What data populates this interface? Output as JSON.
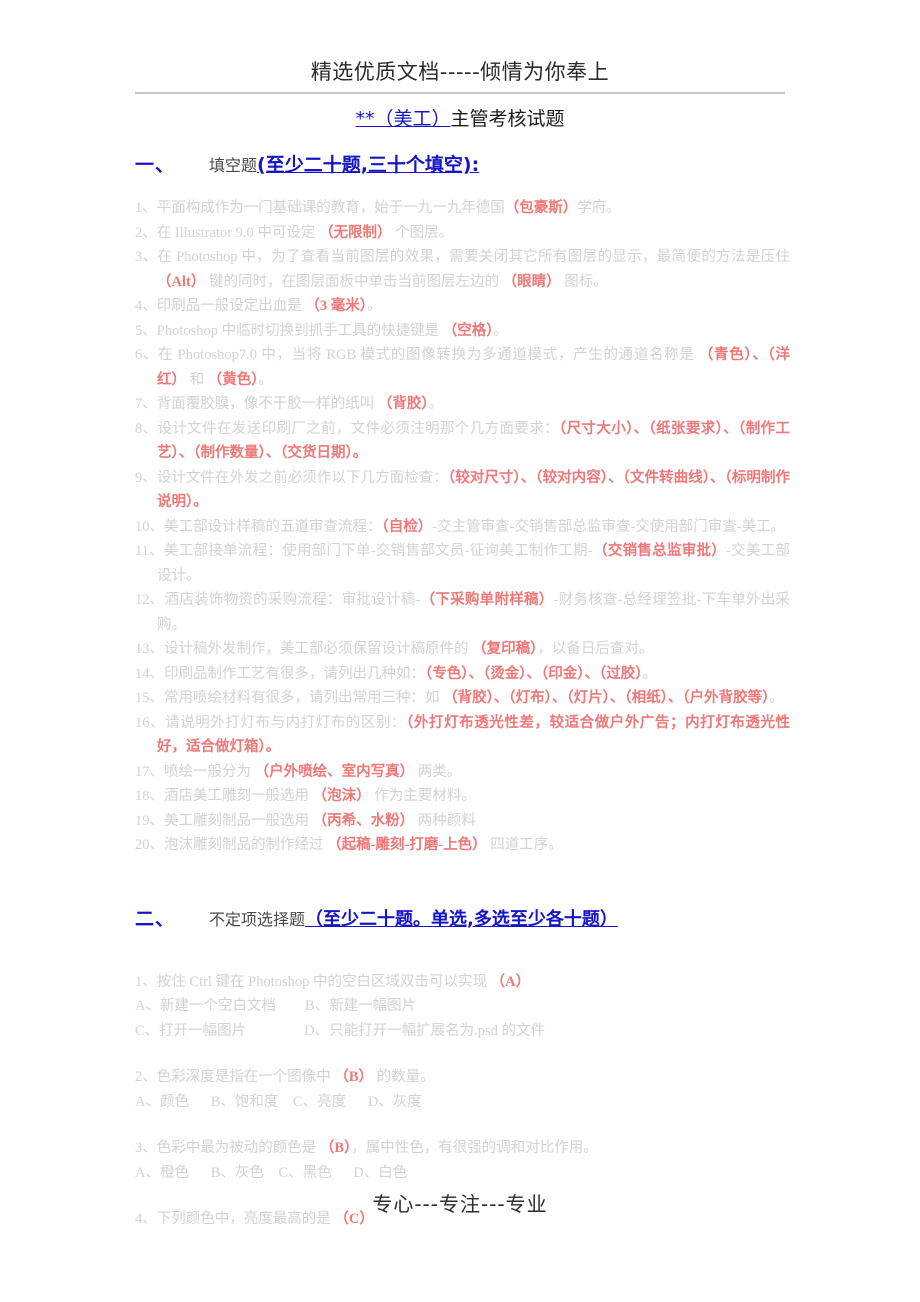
{
  "header": {
    "banner": "精选优质文档-----倾情为你奉上"
  },
  "title": {
    "prefix": "**（美工）",
    "suffix": "主管考核试题"
  },
  "sections": [
    {
      "number": "一、",
      "name": "填空题",
      "note": "(至少二十题,三十个填空):"
    },
    {
      "number": "二、",
      "name": "不定项选择题",
      "note": "（至少二十题。单选,多选至少各十题）"
    }
  ],
  "fill_in_questions": [
    {
      "id": "q1",
      "parts": [
        {
          "t": "1、平面构成作为一门基础课的教育，始于一九一九年德国",
          "a": false
        },
        {
          "t": "（包豪斯）",
          "a": true
        },
        {
          "t": "学府。",
          "a": false
        }
      ]
    },
    {
      "id": "q2",
      "parts": [
        {
          "t": "2、在 Illustrator 9.0 中可设定 ",
          "a": false
        },
        {
          "t": "（无限制）",
          "a": true
        },
        {
          "t": " 个图层。",
          "a": false
        }
      ]
    },
    {
      "id": "q3",
      "parts": [
        {
          "t": "3、在 Photoshop 中，为了查看当前图层的效果，需要关闭其它所有图层的显示，最简便的方法是压住 ",
          "a": false
        },
        {
          "t": "（Alt）",
          "a": true
        },
        {
          "t": " 键的同时，在图层面板中单击当前图层左边的 ",
          "a": false
        },
        {
          "t": "（眼睛）",
          "a": true
        },
        {
          "t": " 图标。",
          "a": false
        }
      ]
    },
    {
      "id": "q4",
      "parts": [
        {
          "t": "4、印刷品一般设定出血是 ",
          "a": false
        },
        {
          "t": "（3 毫米）",
          "a": true
        },
        {
          "t": "。",
          "a": false
        }
      ]
    },
    {
      "id": "q5",
      "parts": [
        {
          "t": "5、Photoshop 中临时切换到抓手工具的快捷键是 ",
          "a": false
        },
        {
          "t": "（空格）",
          "a": true
        },
        {
          "t": "。",
          "a": false
        }
      ]
    },
    {
      "id": "q6",
      "parts": [
        {
          "t": "6、在 Photoshop7.0 中，当将 RGB 模式的图像转换为多通道模式，产生的通道名称是 ",
          "a": false
        },
        {
          "t": "（青色）、（洋红）",
          "a": true
        },
        {
          "t": " 和 ",
          "a": false
        },
        {
          "t": "（黄色）",
          "a": true
        },
        {
          "t": "。",
          "a": false
        }
      ]
    },
    {
      "id": "q7",
      "parts": [
        {
          "t": "7、背面覆胶膜，像不干胶一样的纸叫 ",
          "a": false
        },
        {
          "t": "（背胶）",
          "a": true
        },
        {
          "t": "。",
          "a": false
        }
      ]
    },
    {
      "id": "q8",
      "parts": [
        {
          "t": "8、设计文件在发送印刷厂之前，文件必须注明那个几方面要求：",
          "a": false
        },
        {
          "t": "（尺寸大小）、（纸张要求）、（制作工艺）、（制作数量）、（交货日期）。",
          "a": true
        }
      ]
    },
    {
      "id": "q9",
      "parts": [
        {
          "t": "9、设计文件在外发之前必须作以下几方面检查：",
          "a": false
        },
        {
          "t": "（较对尺寸）、（较对内容）、（文件转曲线）、（标明制作说明）。",
          "a": true
        }
      ]
    },
    {
      "id": "q10",
      "parts": [
        {
          "t": "10、美工部设计样稿的五道审查流程：",
          "a": false
        },
        {
          "t": "（自检）",
          "a": true
        },
        {
          "t": "-交主管审查-交销售部总监审查-交使用部门审查-美工。",
          "a": false
        }
      ]
    },
    {
      "id": "q11",
      "parts": [
        {
          "t": "11、美工部接单流程：使用部门下单-交销售部文员-征询美工制作工期-",
          "a": false
        },
        {
          "t": "（交销售总监审批）",
          "a": true
        },
        {
          "t": "-交美工部设计。",
          "a": false
        }
      ]
    },
    {
      "id": "q12",
      "parts": [
        {
          "t": "12、酒店装饰物资的采购流程：审批设计稿-",
          "a": false
        },
        {
          "t": "（下采购单附样稿）",
          "a": true
        },
        {
          "t": "-财务核查-总经理签批-下车单外出采购。",
          "a": false
        }
      ]
    },
    {
      "id": "q13",
      "parts": [
        {
          "t": "13、设计稿外发制作，美工部必须保留设计稿原件的 ",
          "a": false
        },
        {
          "t": "（复印稿）",
          "a": true
        },
        {
          "t": "，以备日后查对。",
          "a": false
        }
      ]
    },
    {
      "id": "q14",
      "parts": [
        {
          "t": "14、印刷品制作工艺有很多，请列出几种如：",
          "a": false
        },
        {
          "t": "（专色）、（烫金）、（印金）、（过胶）",
          "a": true
        },
        {
          "t": "。",
          "a": false
        }
      ]
    },
    {
      "id": "q15",
      "parts": [
        {
          "t": "15、常用喷绘材料有很多，请列出常用三种：如 ",
          "a": false
        },
        {
          "t": "（背胶）、（灯布）、（灯片）、（相纸）、（户外背胶等）",
          "a": true
        },
        {
          "t": "。",
          "a": false
        }
      ]
    },
    {
      "id": "q16",
      "parts": [
        {
          "t": "16、请说明外打灯布与内打灯布的区别：",
          "a": false
        },
        {
          "t": "（外打灯布透光性差，较适合做户外广告；内打灯布透光性好，适合做灯箱）。",
          "a": true
        }
      ]
    },
    {
      "id": "q17",
      "parts": [
        {
          "t": "17、喷绘一般分为 ",
          "a": false
        },
        {
          "t": "（户外喷绘、室内写真）",
          "a": true
        },
        {
          "t": " 两类。",
          "a": false
        }
      ]
    },
    {
      "id": "q18",
      "parts": [
        {
          "t": "18、酒店美工雕刻一般选用 ",
          "a": false
        },
        {
          "t": "（泡沫）",
          "a": true
        },
        {
          "t": " 作为主要材料。",
          "a": false
        }
      ]
    },
    {
      "id": "q19",
      "parts": [
        {
          "t": "19、美工雕刻制品一般选用 ",
          "a": false
        },
        {
          "t": "（丙希、水粉）",
          "a": true
        },
        {
          "t": " 两种颜料",
          "a": false
        }
      ]
    },
    {
      "id": "q20",
      "parts": [
        {
          "t": "20、泡沫雕刻制品的制作经过 ",
          "a": false
        },
        {
          "t": "（起稿-雕刻-打磨-上色）",
          "a": true
        },
        {
          "t": " 四道工序。",
          "a": false
        }
      ]
    }
  ],
  "choice_questions": [
    {
      "id": "c1",
      "stem_before": "1、按住 Ctrl 键在 Photoshop 中的空白区域双击可以实现 ",
      "answer": "（A）",
      "stem_after": "",
      "option_lines": [
        "A、新建一个空白文档        B、新建一幅图片",
        "C、打开一幅图片                D、只能打开一幅扩展名为.psd 的文件"
      ]
    },
    {
      "id": "c2",
      "stem_before": "2、色彩深度是指在一个图像中 ",
      "answer": "（B）",
      "stem_after": " 的数量。",
      "option_lines": [
        "A、颜色      B、饱和度    C、亮度      D、灰度"
      ]
    },
    {
      "id": "c3",
      "stem_before": "3、色彩中最为被动的颜色是 ",
      "answer": "（B）",
      "stem_after": "，属中性色，有很强的调和对比作用。",
      "option_lines": [
        "A、橙色      B、灰色    C、黑色      D、白色"
      ]
    },
    {
      "id": "c4",
      "stem_before": "4、下列颜色中，亮度最高的是 ",
      "answer": "（C）",
      "stem_after": "",
      "option_lines": []
    }
  ],
  "footer": {
    "text": "专心---专注---专业"
  },
  "colors": {
    "heading_blue": "#1414c8",
    "answer_red": "#f07878",
    "body_gray": "#d2d2d2",
    "title_black": "#1a1a1a"
  }
}
